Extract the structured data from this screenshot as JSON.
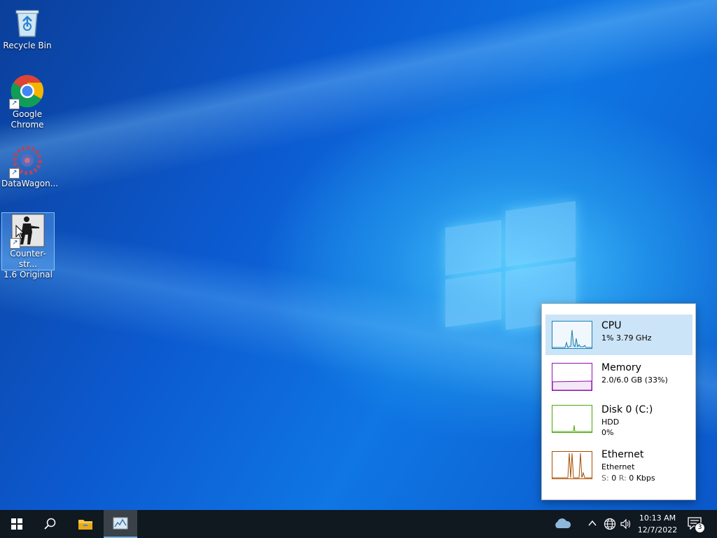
{
  "desktop": {
    "icons": [
      {
        "label": "Recycle Bin"
      },
      {
        "label": "Google Chrome"
      },
      {
        "label": "DataWagon..."
      },
      {
        "label_line1": "Counter-str...",
        "label_line2": "1.6 Original"
      }
    ]
  },
  "perf_panel": {
    "cpu": {
      "title": "CPU",
      "detail": "1%  3.79 GHz",
      "color": "#1a7fb5"
    },
    "memory": {
      "title": "Memory",
      "detail": "2.0/6.0 GB (33%)",
      "color": "#8b12ae"
    },
    "disk": {
      "title": "Disk 0 (C:)",
      "detail1": "HDD",
      "detail2": "0%",
      "color": "#4da60c"
    },
    "ethernet": {
      "title": "Ethernet",
      "detail1": "Ethernet",
      "send_label": "S:",
      "send_value": "0",
      "recv_label": "R:",
      "recv_value": "0 Kbps",
      "color": "#a74f01"
    }
  },
  "taskbar": {
    "tray_badge": "3",
    "clock_time": "10:13 AM",
    "clock_date": "12/7/2022",
    "icons": [
      "windows-start-icon",
      "search-icon",
      "file-explorer-icon",
      "task-manager-icon",
      "onedrive-icon",
      "chevron-up-icon",
      "network-icon",
      "volume-icon",
      "notification-icon"
    ]
  }
}
